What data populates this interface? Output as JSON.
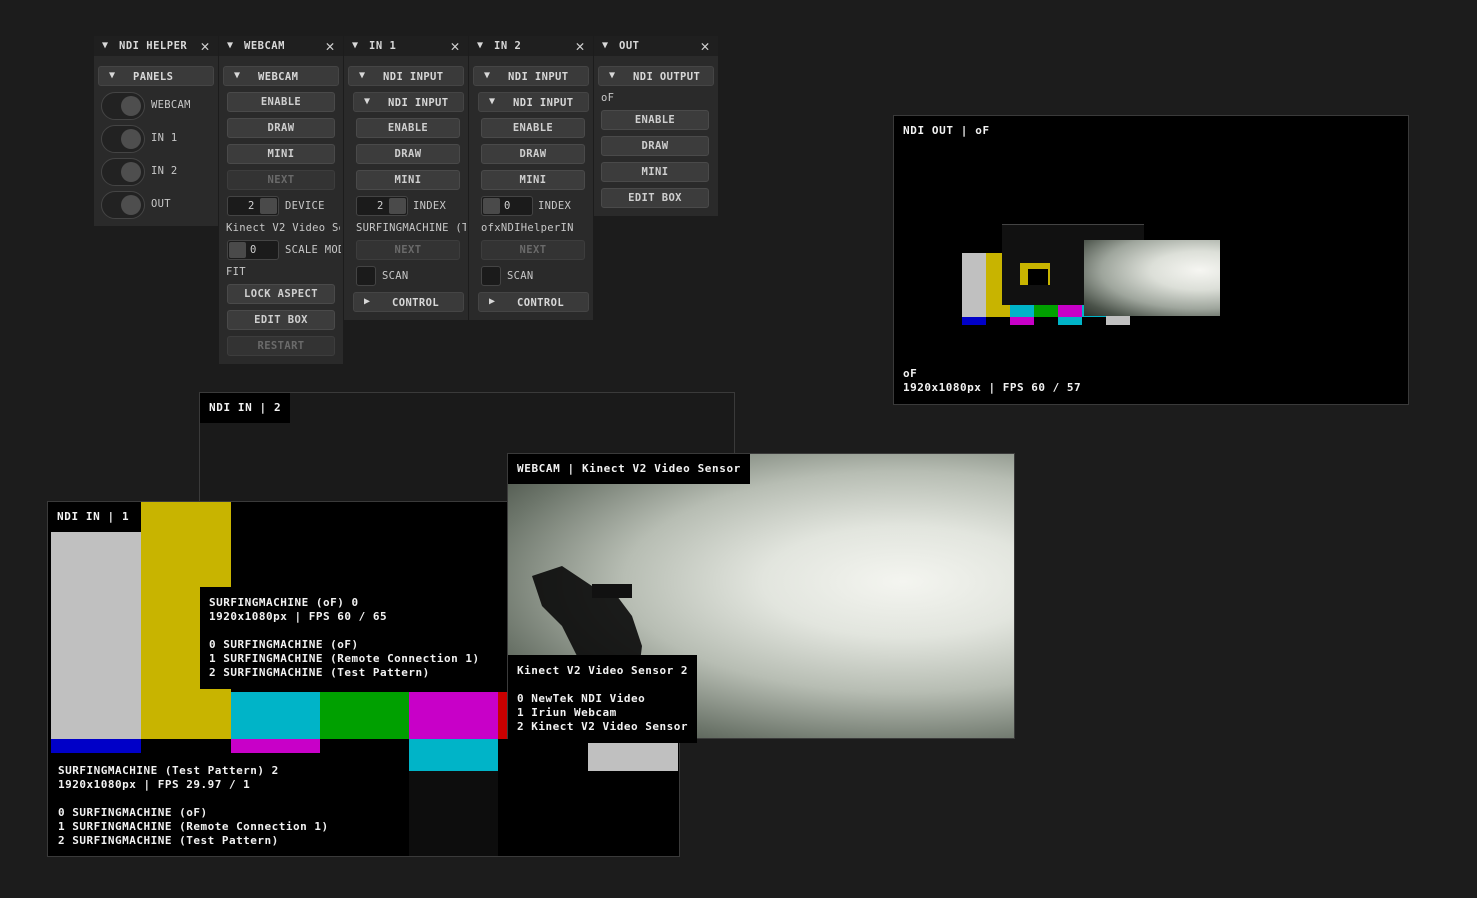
{
  "panels": {
    "helper": {
      "title": "NDI HELPER",
      "group": "PANELS",
      "toggles": [
        "WEBCAM",
        "IN 1",
        "IN 2",
        "OUT"
      ]
    },
    "webcam": {
      "title": "WEBCAM",
      "group": "WEBCAM",
      "enable": "ENABLE",
      "draw": "DRAW",
      "mini": "MINI",
      "next": "NEXT",
      "device_value": "2",
      "device_label": "DEVICE",
      "device_name": "Kinect V2 Video Se",
      "scale_value": "0",
      "scale_label": "SCALE MOD",
      "fit": "FIT",
      "lock_aspect": "LOCK ASPECT",
      "edit_box": "EDIT BOX",
      "restart": "RESTART"
    },
    "in1": {
      "title": "IN 1",
      "group": "NDI INPUT",
      "subgroup": "NDI INPUT",
      "enable": "ENABLE",
      "draw": "DRAW",
      "mini": "MINI",
      "index_value": "2",
      "index_label": "INDEX",
      "source": "SURFINGMACHINE (T",
      "next": "NEXT",
      "scan": "SCAN",
      "control": "CONTROL"
    },
    "in2": {
      "title": "IN 2",
      "group": "NDI INPUT",
      "subgroup": "NDI INPUT",
      "enable": "ENABLE",
      "draw": "DRAW",
      "mini": "MINI",
      "index_value": "0",
      "index_label": "INDEX",
      "source": "ofxNDIHelperIN",
      "next": "NEXT",
      "scan": "SCAN",
      "control": "CONTROL"
    },
    "out": {
      "title": "OUT",
      "group": "NDI OUTPUT",
      "name": "oF",
      "enable": "ENABLE",
      "draw": "DRAW",
      "mini": "MINI",
      "edit_box": "EDIT BOX"
    }
  },
  "windows": {
    "out": {
      "title": "NDI OUT | oF",
      "info": "oF\n1920x1080px | FPS 60 / 57"
    },
    "in2": {
      "title": "NDI IN | 2",
      "info": "SURFINGMACHINE (oF) 0\n1920x1080px | FPS 60 / 65\n\n0 SURFINGMACHINE (oF)\n1 SURFINGMACHINE (Remote Connection 1)\n2 SURFINGMACHINE (Test Pattern)"
    },
    "webcam": {
      "title": "WEBCAM | Kinect V2 Video Sensor",
      "info": "Kinect V2 Video Sensor 2\n\n0 NewTek NDI Video\n1 Iriun Webcam\n2 Kinect V2 Video Sensor"
    },
    "in1": {
      "title": "NDI IN | 1",
      "info": "SURFINGMACHINE (Test Pattern) 2\n1920x1080px | FPS 29.97 / 1\n\n0 SURFINGMACHINE (oF)\n1 SURFINGMACHINE (Remote Connection 1)\n2 SURFINGMACHINE (Test Pattern)"
    }
  },
  "icons": {
    "collapse": "triangle-down-icon",
    "expand": "triangle-right-icon",
    "close": "close-icon"
  },
  "colors": {
    "background": "#1c1c1c",
    "panel": "#2a2a2a",
    "test_pattern": [
      "#c0c0c0",
      "#c8b400",
      "#00b4c8",
      "#00a000",
      "#c800c8",
      "#c80000",
      "#0000c8"
    ]
  }
}
